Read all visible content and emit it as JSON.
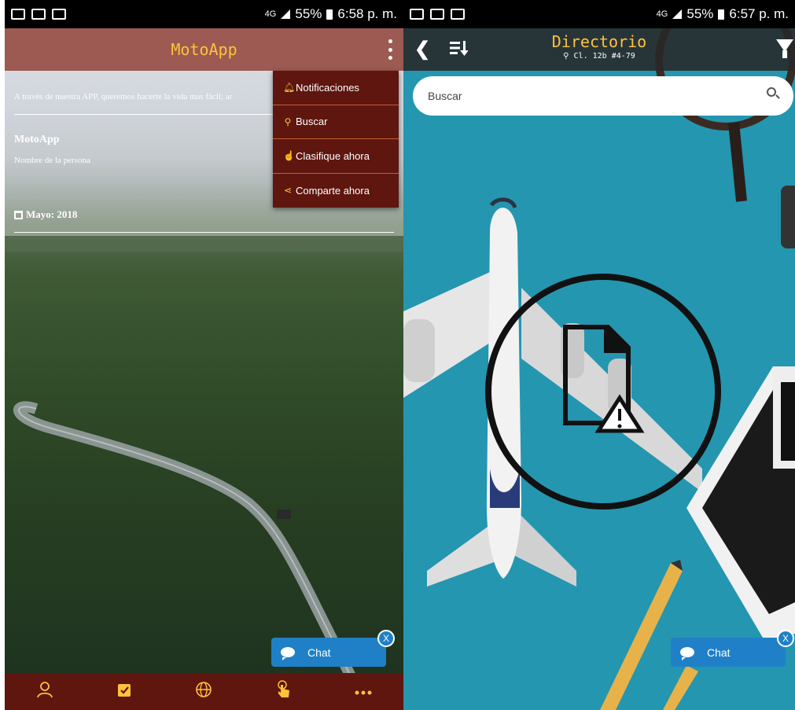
{
  "left": {
    "status": {
      "time": "6:58 p. m.",
      "battery": "55%",
      "network": "4G"
    },
    "app_title": "MotoApp",
    "intro_text": "A través de nuestra APP, queremos hacerte la vida mas fácil; ar",
    "profile_name": "MotoApp",
    "profile_sub": "Nombre de la persona",
    "date_label": "Mayo: 2018",
    "menu": {
      "items": [
        {
          "label": "Notificaciones",
          "icon": "bell-icon"
        },
        {
          "label": "Buscar",
          "icon": "search-icon"
        },
        {
          "label": "Clasifique ahora",
          "icon": "thumbs-up-icon"
        },
        {
          "label": "Comparte ahora",
          "icon": "share-icon"
        }
      ]
    },
    "chat": {
      "label": "Chat",
      "close": "X"
    },
    "bottom_nav": [
      "user-icon",
      "checklist-icon",
      "globe-icon",
      "touch-icon",
      "more-icon"
    ]
  },
  "right": {
    "status": {
      "time": "6:57 p. m.",
      "battery": "55%",
      "network": "4G"
    },
    "title": "Directorio",
    "address": "Cl. 12b #4-79",
    "search": {
      "placeholder": "Buscar"
    },
    "chat": {
      "label": "Chat",
      "close": "X"
    }
  },
  "colors": {
    "header_red": "#9d5a52",
    "menu_bg": "#5e160f",
    "accent_yellow": "#ffc23d",
    "chat_blue": "#1f80c8",
    "sky_blue": "#2496b0"
  }
}
